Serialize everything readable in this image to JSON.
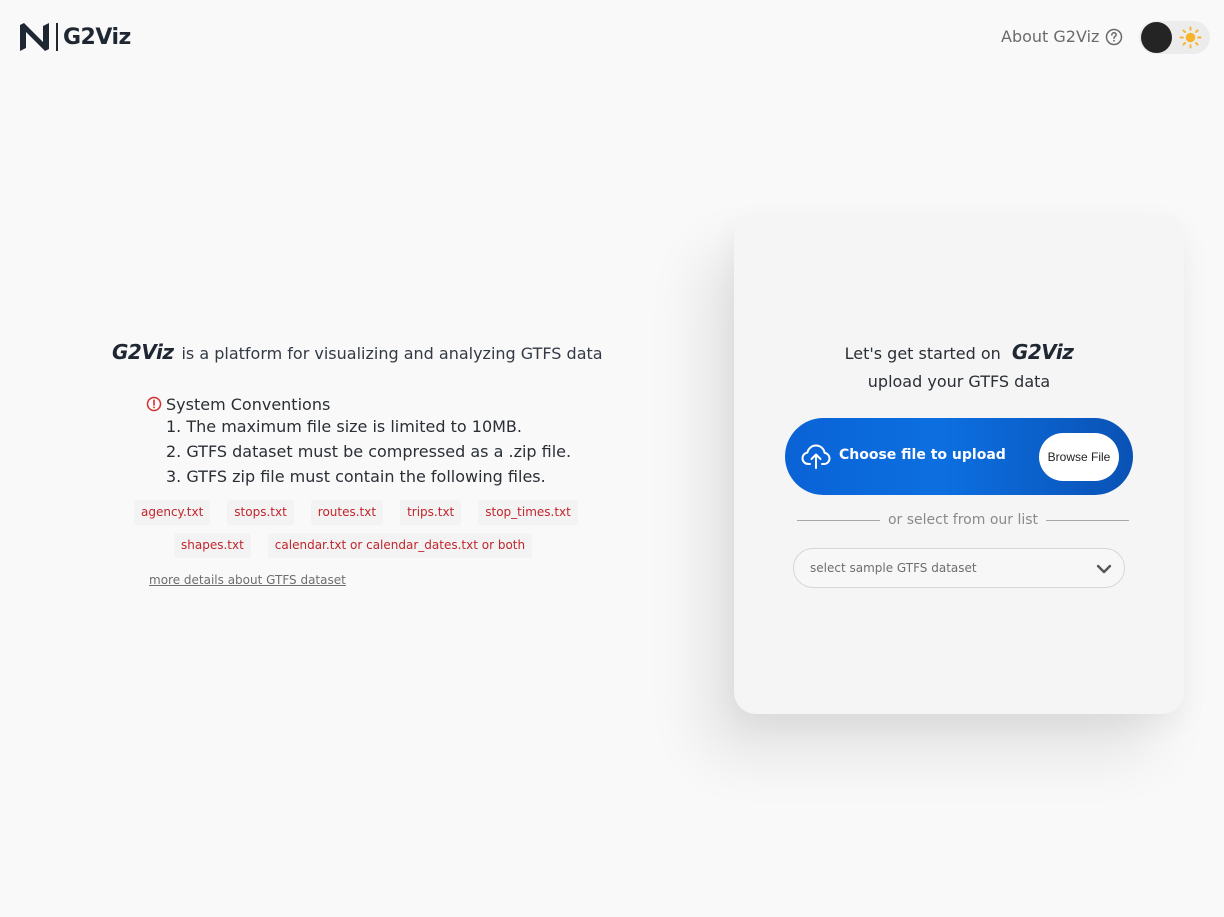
{
  "header": {
    "logo_text": "G2Viz",
    "about_label": "About G2Viz",
    "icons": {
      "help": "question-circle-icon",
      "logo": "n-logo-icon",
      "theme": "sun-icon"
    }
  },
  "intro": {
    "brand": "G2Viz",
    "tagline": "is a platform for visualizing and analyzing GTFS data"
  },
  "conventions": {
    "title": "System Conventions",
    "items": [
      "1. The maximum file size is limited to 10MB.",
      "2. GTFS dataset must be compressed as a .zip file.",
      "3. GTFS zip file must contain the following files."
    ],
    "files_row1": [
      "agency.txt",
      "stops.txt",
      "routes.txt",
      "trips.txt",
      "stop_times.txt"
    ],
    "files_row2": [
      "shapes.txt",
      "calendar.txt or calendar_dates.txt or both"
    ],
    "more_link": "more details about GTFS dataset"
  },
  "card": {
    "title_prefix": "Let's get started on",
    "brand": "G2Viz",
    "subtitle": "upload your GTFS data",
    "upload_label": "Choose file to upload",
    "browse_label": "Browse File",
    "divider_text": "or select from our list",
    "select_placeholder": "select sample GTFS dataset"
  },
  "colors": {
    "accent": "#0a63d6",
    "file_chip_text": "#c0262d",
    "background": "#f9f9f9"
  }
}
